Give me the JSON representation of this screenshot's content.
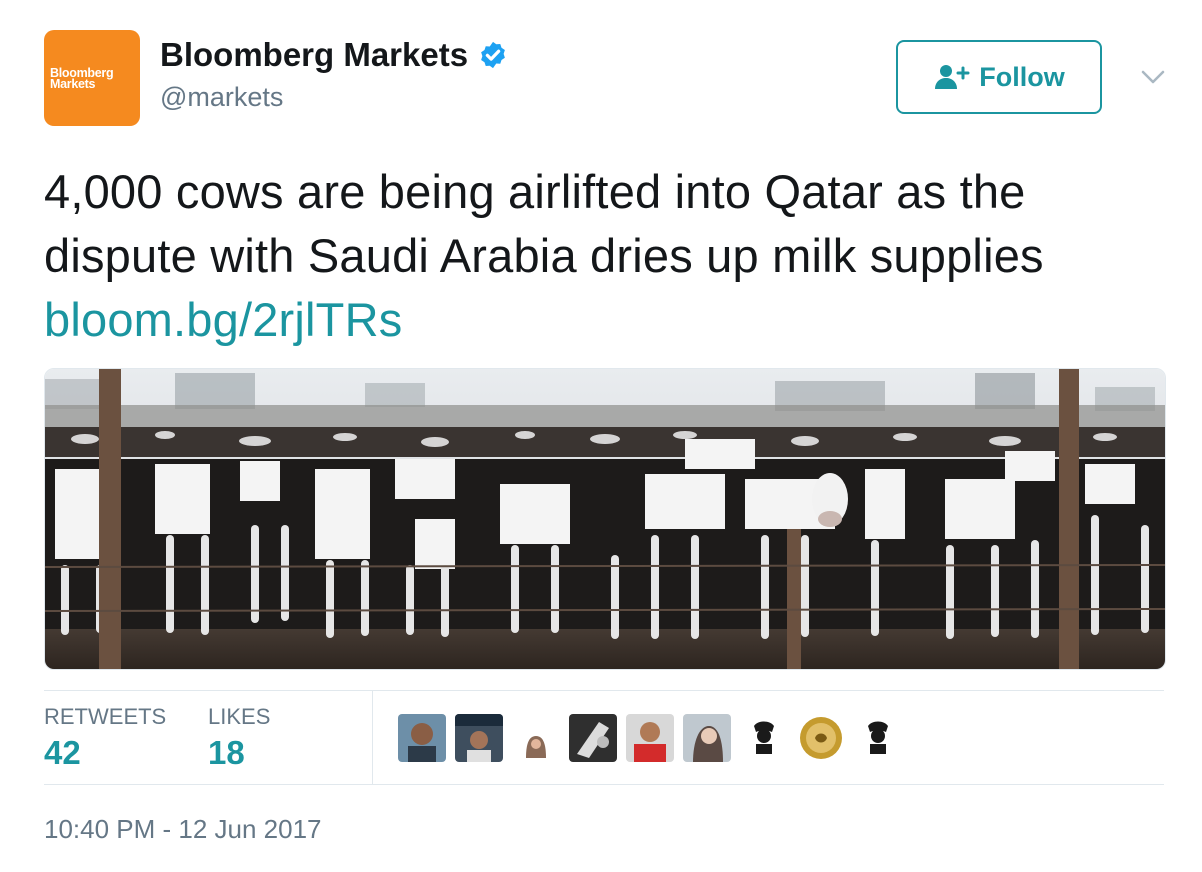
{
  "author": {
    "avatar_text": [
      "Bloomberg",
      "Markets"
    ],
    "display_name": "Bloomberg Markets",
    "handle": "@markets",
    "verified": true,
    "avatar_color": "#f58a1f"
  },
  "follow_button": {
    "label": "Follow",
    "icon": "add-user-icon"
  },
  "menu": {
    "icon": "chevron-down-icon"
  },
  "tweet": {
    "text": "4,000 cows are being airlifted into Qatar as the dispute with Saudi Arabia dries up milk supplies",
    "link": "bloom.bg/2rjlTRs"
  },
  "stats": {
    "retweets_label": "RETWEETS",
    "retweets_count": "42",
    "likes_label": "LIKES",
    "likes_count": "18"
  },
  "likers": [
    "profile-photo",
    "profile-photo",
    "profile-photo",
    "profile-photo",
    "profile-photo",
    "profile-photo",
    "profile-photo",
    "seal-logo",
    "profile-photo"
  ],
  "timestamp": "10:40 PM - 12 Jun 2017",
  "colors": {
    "accent": "#1b95a0",
    "verified": "#1da1f2",
    "secondary_text": "#657786"
  }
}
